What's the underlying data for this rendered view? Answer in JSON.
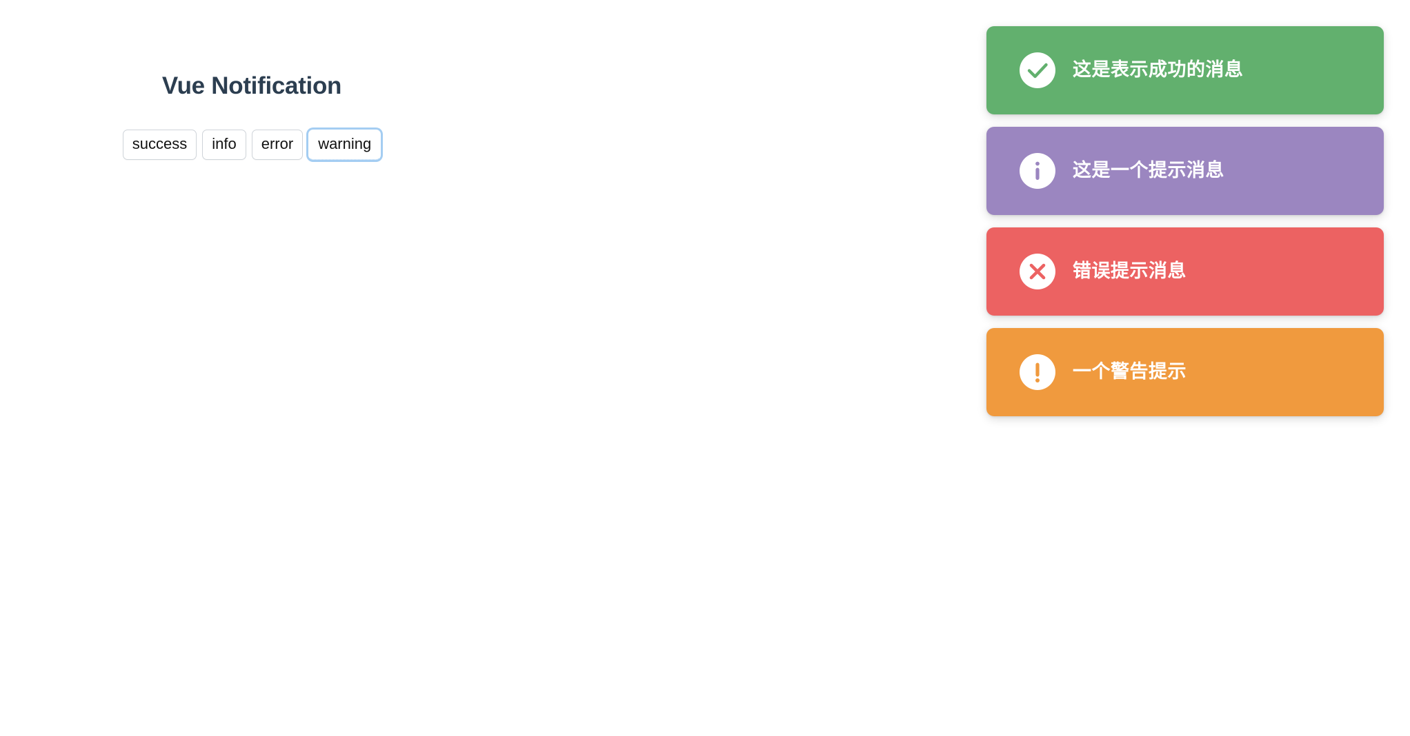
{
  "page": {
    "title": "Vue Notification",
    "background_color": "#ffffff",
    "title_color": "#2c3e50"
  },
  "controls": {
    "buttons": [
      {
        "label": "success",
        "name": "success-button",
        "focused": false
      },
      {
        "label": "info",
        "name": "info-button",
        "focused": false
      },
      {
        "label": "error",
        "name": "error-button",
        "focused": false
      },
      {
        "label": "warning",
        "name": "warning-button",
        "focused": true
      }
    ],
    "focus_ring_color": "#a4cdf2"
  },
  "notifications": [
    {
      "type": "success",
      "message": "这是表示成功的消息",
      "icon": "check-circle-icon",
      "background_color": "#62b06e",
      "icon_circle_color": "#ffffff",
      "text_color": "#ffffff"
    },
    {
      "type": "info",
      "message": "这是一个提示消息",
      "icon": "info-circle-icon",
      "background_color": "#9b86c0",
      "icon_circle_color": "#ffffff",
      "text_color": "#ffffff"
    },
    {
      "type": "error",
      "message": "错误提示消息",
      "icon": "close-circle-icon",
      "background_color": "#ec6262",
      "icon_circle_color": "#ffffff",
      "text_color": "#ffffff"
    },
    {
      "type": "warning",
      "message": "一个警告提示",
      "icon": "exclamation-circle-icon",
      "background_color": "#f09a3e",
      "icon_circle_color": "#ffffff",
      "text_color": "#ffffff"
    }
  ]
}
